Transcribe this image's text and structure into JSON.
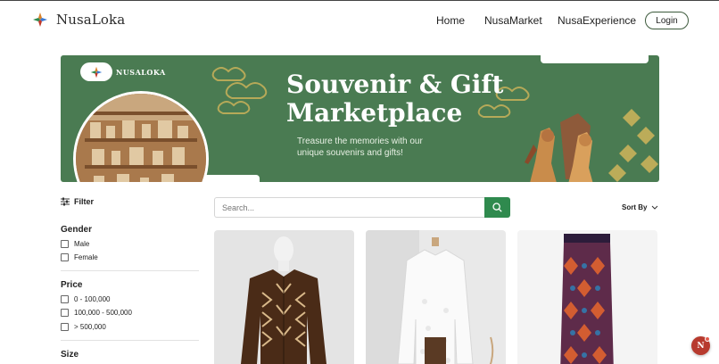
{
  "brand": {
    "name": "NusaLoka"
  },
  "nav": {
    "links": [
      "Home",
      "NusaMarket",
      "NusaExperience"
    ],
    "login": "Login"
  },
  "banner": {
    "brand": "NUSALOKA",
    "title_line1": "Souvenir & Gift",
    "title_line2": "Marketplace",
    "subtitle": "Treasure the memories with our unique souvenirs and gifts!"
  },
  "filters": {
    "label": "Filter",
    "groups": [
      {
        "title": "Gender",
        "options": [
          "Male",
          "Female"
        ]
      },
      {
        "title": "Price",
        "options": [
          "0 - 100,000",
          "100,000 - 500,000",
          "> 500,000"
        ]
      },
      {
        "title": "Size",
        "options": []
      }
    ]
  },
  "search": {
    "placeholder": "Search..."
  },
  "sort": {
    "label": "Sort By"
  },
  "products": [
    {
      "icon": "batik-shirt-image"
    },
    {
      "icon": "kebaya-image"
    },
    {
      "icon": "songket-skirt-image"
    }
  ],
  "fab": {
    "initial": "N"
  },
  "colors": {
    "accent": "#2f8a4e",
    "banner": "#4a7b52",
    "login_border": "#3d5a3c"
  }
}
